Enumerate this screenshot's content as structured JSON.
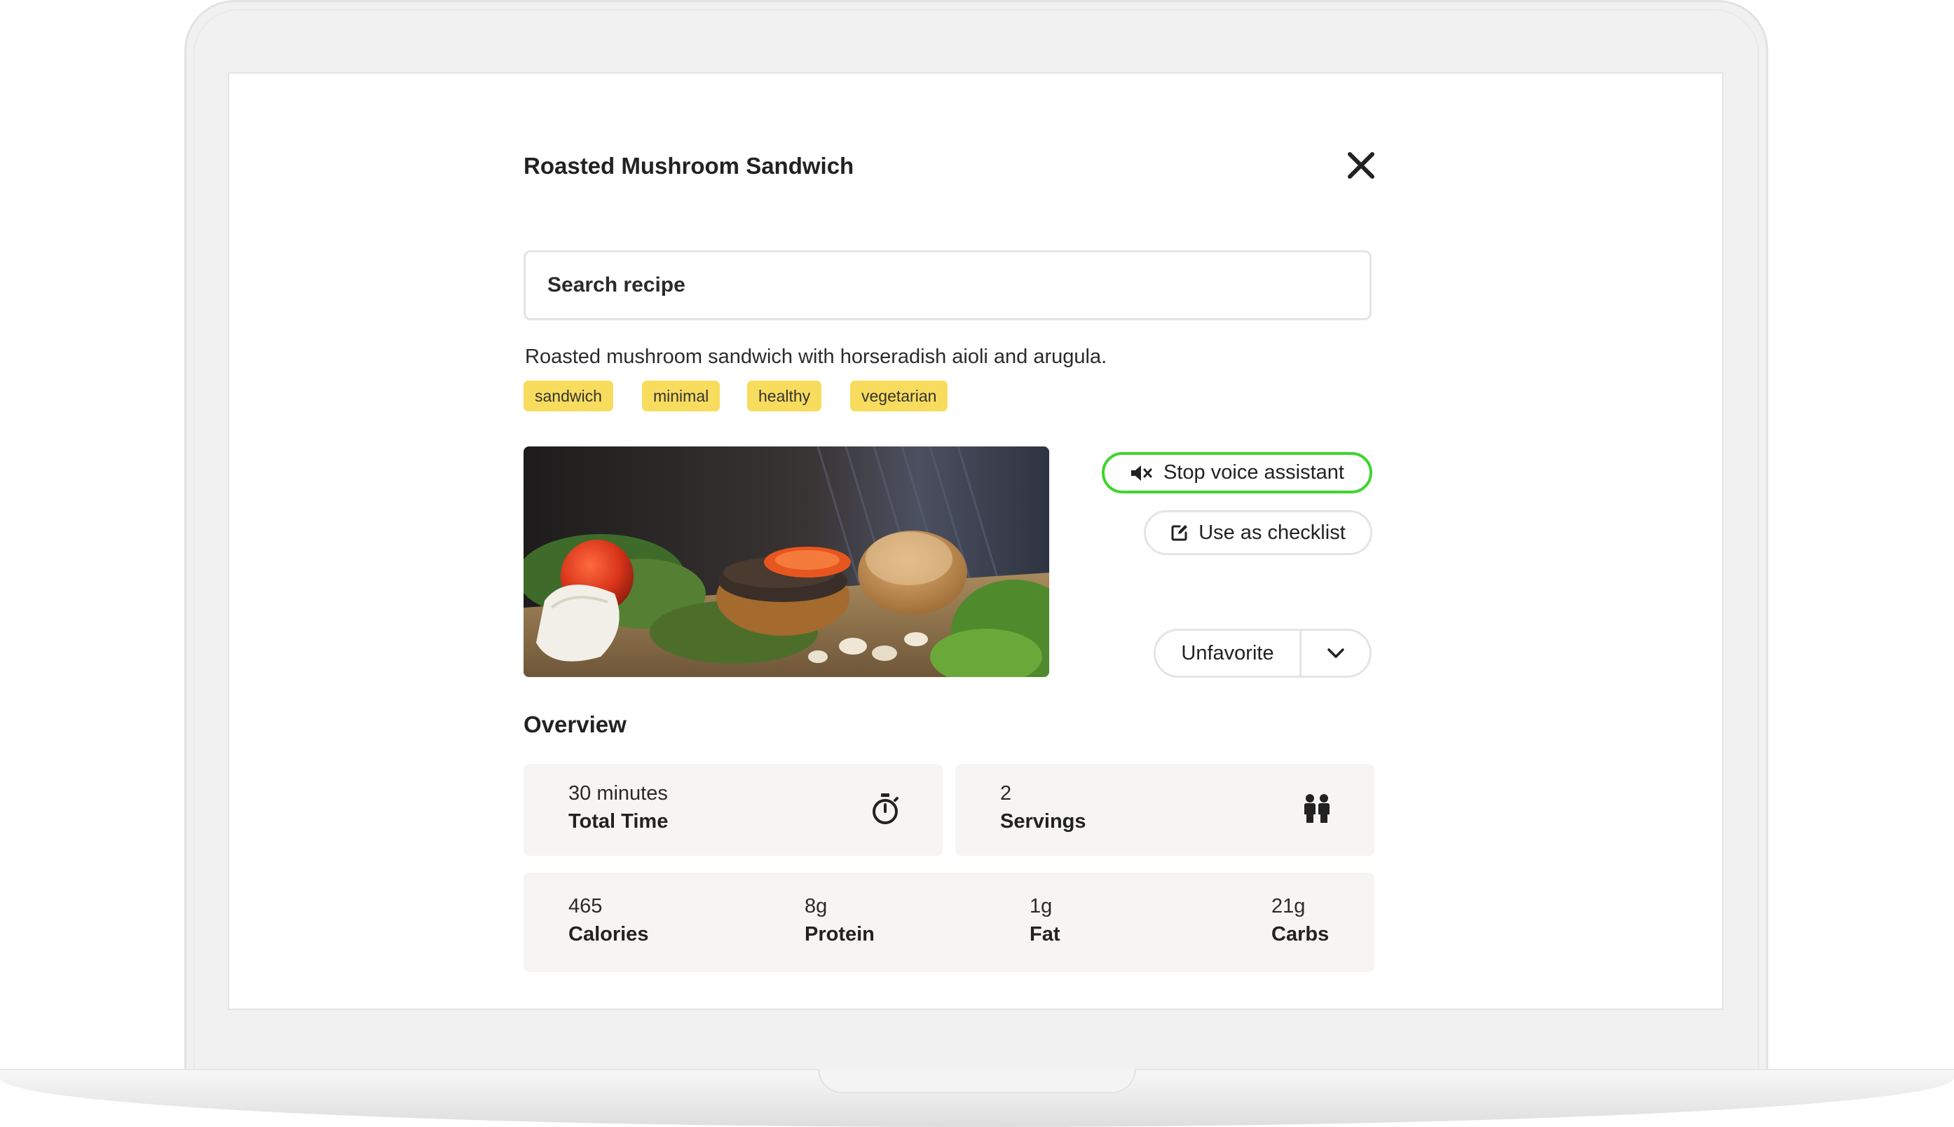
{
  "recipe": {
    "title": "Roasted Mushroom Sandwich",
    "description": "Roasted mushroom sandwich with horseradish aioli and arugula.",
    "tags": [
      "sandwich",
      "minimal",
      "healthy",
      "vegetarian"
    ]
  },
  "search": {
    "placeholder": "Search recipe"
  },
  "actions": {
    "voice_label": "Stop voice assistant",
    "checklist_label": "Use as checklist",
    "favorite_label": "Unfavorite"
  },
  "overview": {
    "heading": "Overview",
    "time": {
      "value": "30 minutes",
      "label": "Total Time"
    },
    "servings": {
      "value": "2",
      "label": "Servings"
    },
    "nutrition": [
      {
        "value": "465",
        "label": "Calories"
      },
      {
        "value": "8g",
        "label": "Protein"
      },
      {
        "value": "1g",
        "label": "Fat"
      },
      {
        "value": "21g",
        "label": "Carbs"
      }
    ]
  },
  "icons": {
    "close": "close-icon",
    "voice": "speaker-mute-icon",
    "checklist": "edit-icon",
    "dropdown": "chevron-down-icon",
    "time": "stopwatch-icon",
    "servings": "people-icon"
  },
  "colors": {
    "tag_background": "#f8dc5e",
    "voice_border": "#3fd42e",
    "card_background": "#f6f5f3"
  }
}
